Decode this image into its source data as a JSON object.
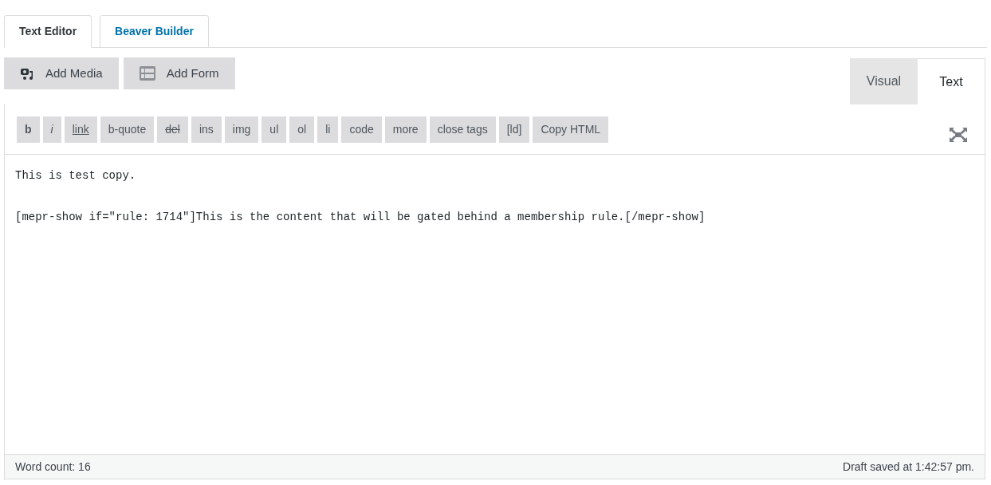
{
  "tabs": [
    {
      "label": "Text Editor",
      "selected": true
    },
    {
      "label": "Beaver Builder",
      "selected": false
    }
  ],
  "media_buttons": [
    {
      "label": "Add Media",
      "kind": "media"
    },
    {
      "label": "Add Form",
      "kind": "form"
    }
  ],
  "mode_tabs": [
    {
      "label": "Visual",
      "selected": false
    },
    {
      "label": "Text",
      "selected": true
    }
  ],
  "quicktags": [
    {
      "label": "b",
      "kind": "bold"
    },
    {
      "label": "i",
      "kind": "italic"
    },
    {
      "label": "link",
      "kind": "underline"
    },
    {
      "label": "b-quote",
      "kind": "plain"
    },
    {
      "label": "del",
      "kind": "strike"
    },
    {
      "label": "ins",
      "kind": "plain"
    },
    {
      "label": "img",
      "kind": "plain"
    },
    {
      "label": "ul",
      "kind": "plain"
    },
    {
      "label": "ol",
      "kind": "plain"
    },
    {
      "label": "li",
      "kind": "plain"
    },
    {
      "label": "code",
      "kind": "plain"
    },
    {
      "label": "more",
      "kind": "plain"
    },
    {
      "label": "close tags",
      "kind": "plain"
    },
    {
      "label": "[ld]",
      "kind": "plain"
    },
    {
      "label": "Copy HTML",
      "kind": "plain"
    }
  ],
  "content_lines": [
    "This is test copy.",
    "[mepr-show if=\"rule: 1714\"]This is the content that will be gated behind a membership rule.[/mepr-show]"
  ],
  "status_bar": {
    "word_count": "Word count: 16",
    "saved": "Draft saved at 1:42:57 pm."
  }
}
